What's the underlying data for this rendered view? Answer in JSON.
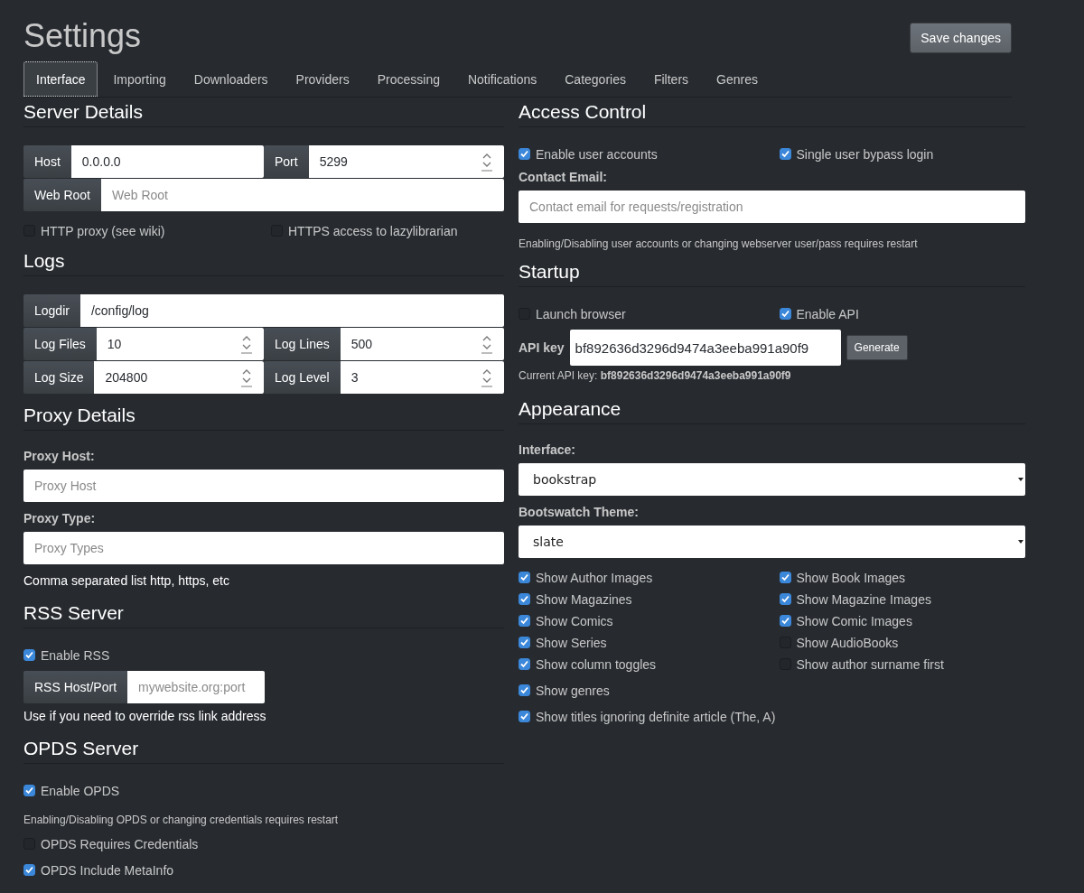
{
  "title": "Settings",
  "save_button": "Save changes",
  "tabs": [
    {
      "label": "Interface",
      "selected": true
    },
    {
      "label": "Importing",
      "selected": false
    },
    {
      "label": "Downloaders",
      "selected": false
    },
    {
      "label": "Providers",
      "selected": false
    },
    {
      "label": "Processing",
      "selected": false
    },
    {
      "label": "Notifications",
      "selected": false
    },
    {
      "label": "Categories",
      "selected": false
    },
    {
      "label": "Filters",
      "selected": false
    },
    {
      "label": "Genres",
      "selected": false
    }
  ],
  "left": [
    {
      "heading": "Server Details",
      "items": [
        {
          "kind": "addons",
          "groups": [
            {
              "addon": "Host",
              "kind": "text",
              "value": "0.0.0.0"
            },
            {
              "addon": "Port",
              "kind": "number",
              "value": "5299"
            }
          ]
        },
        {
          "kind": "addons",
          "groups": [
            {
              "addon": "Web Root",
              "kind": "text",
              "placeholder": "Web Root"
            }
          ]
        },
        {
          "kind": "checks",
          "items": [
            {
              "label": "HTTP proxy (see wiki)",
              "checked": false
            },
            {
              "label": "HTTPS access to lazylibrarian",
              "checked": false
            }
          ]
        }
      ]
    },
    {
      "heading": "Logs",
      "items": [
        {
          "kind": "addons",
          "groups": [
            {
              "addon": "Logdir",
              "kind": "text",
              "value": "/config/log"
            }
          ]
        },
        {
          "kind": "addons",
          "groups": [
            {
              "addon": "Log Files",
              "kind": "number",
              "value": "10"
            },
            {
              "addon": "Log Lines",
              "kind": "number",
              "value": "500"
            }
          ]
        },
        {
          "kind": "addons",
          "groups": [
            {
              "addon": "Log Size",
              "kind": "number",
              "value": "204800"
            },
            {
              "addon": "Log Level",
              "kind": "number",
              "value": "3"
            }
          ]
        }
      ]
    },
    {
      "heading": "Proxy Details",
      "items": [
        {
          "kind": "field",
          "label": "Proxy Host:",
          "placeholder": "Proxy Host"
        },
        {
          "kind": "field",
          "label": "Proxy Type:",
          "placeholder": "Proxy Types"
        },
        {
          "kind": "help",
          "text": "Comma separated list http, https, etc"
        }
      ]
    },
    {
      "heading": "RSS Server",
      "items": [
        {
          "kind": "check",
          "label": "Enable RSS",
          "checked": true
        },
        {
          "kind": "addons-short",
          "groups": [
            {
              "addon": "RSS Host/Port",
              "kind": "text",
              "placeholder": "mywebsite.org:port"
            }
          ]
        },
        {
          "kind": "help",
          "text": "Use if you need to override rss link address"
        }
      ]
    },
    {
      "heading": "OPDS Server",
      "items": [
        {
          "kind": "check",
          "label": "Enable OPDS",
          "checked": true
        },
        {
          "kind": "note",
          "text": "Enabling/Disabling OPDS or changing credentials requires restart"
        },
        {
          "kind": "check",
          "label": "OPDS Requires Credentials",
          "checked": false
        },
        {
          "kind": "check",
          "label": "OPDS Include MetaInfo",
          "checked": true
        }
      ]
    }
  ],
  "right": [
    {
      "heading": "Access Control",
      "items": [
        {
          "kind": "checks",
          "items": [
            {
              "label": "Enable user accounts",
              "checked": true
            },
            {
              "label": "Single user bypass login",
              "checked": true
            }
          ]
        },
        {
          "kind": "field",
          "label": "Contact Email:",
          "placeholder": "Contact email for requests/registration"
        },
        {
          "kind": "note",
          "text": "Enabling/Disabling user accounts or changing webserver user/pass requires restart"
        }
      ]
    },
    {
      "heading": "Startup",
      "items": [
        {
          "kind": "checks",
          "items": [
            {
              "label": "Launch browser",
              "checked": false
            },
            {
              "label": "Enable API",
              "checked": true
            }
          ]
        },
        {
          "kind": "apikey",
          "label": "API key",
          "value": "bf892636d3296d9474a3eeba991a90f9",
          "button": "Generate"
        },
        {
          "kind": "current",
          "text": "Current API key: **bf892636d3296d9474a3eeba991a90f9**"
        }
      ]
    },
    {
      "heading": "Appearance",
      "items": [
        {
          "kind": "select",
          "label": "Interface:",
          "value": "bookstrap"
        },
        {
          "kind": "select",
          "label": "Bootswatch Theme:",
          "value": "slate"
        },
        {
          "kind": "checks",
          "items": [
            {
              "label": "Show Author Images",
              "checked": true
            },
            {
              "label": "Show Book Images",
              "checked": true
            },
            {
              "label": "Show Magazines",
              "checked": true
            },
            {
              "label": "Show Magazine Images",
              "checked": true
            },
            {
              "label": "Show Comics",
              "checked": true
            },
            {
              "label": "Show Comic Images",
              "checked": true
            },
            {
              "label": "Show Series",
              "checked": true
            },
            {
              "label": "Show AudioBooks",
              "checked": false
            },
            {
              "label": "Show column toggles",
              "checked": true
            },
            {
              "label": "Show author surname first",
              "checked": false
            }
          ]
        },
        {
          "kind": "check",
          "label": "Show genres",
          "checked": true
        },
        {
          "kind": "check",
          "label": "Show titles ignoring definite article (The, A)",
          "checked": true
        }
      ]
    }
  ]
}
